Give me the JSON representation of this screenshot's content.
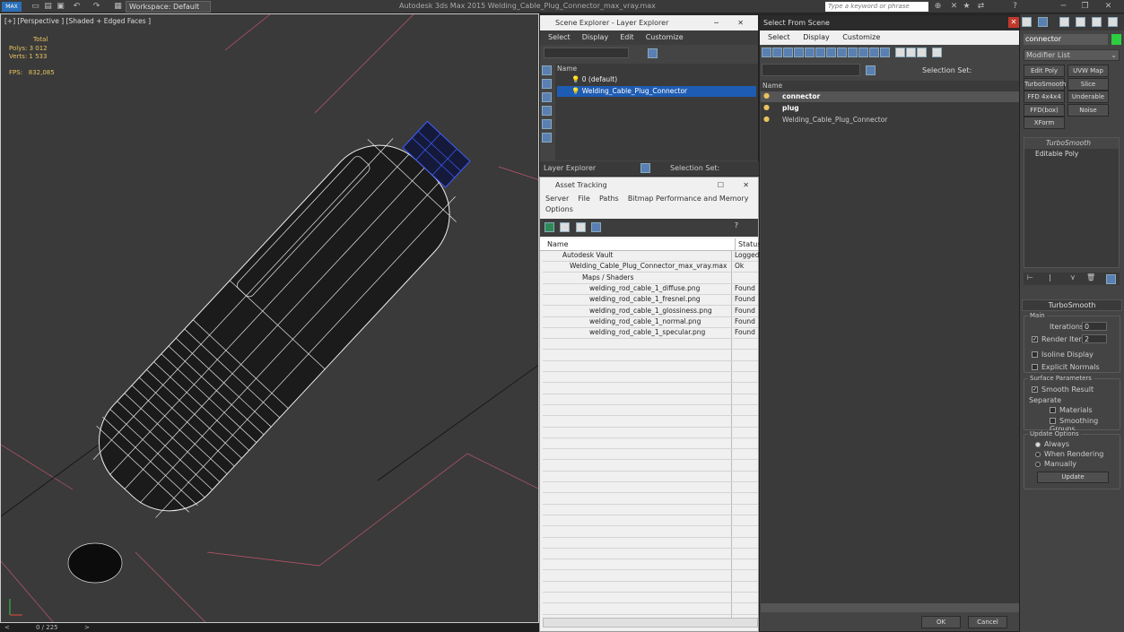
{
  "app": {
    "title": "Autodesk 3ds Max  2015    Welding_Cable_Plug_Connector_max_vray.max",
    "workspace": "Workspace: Default",
    "search_placeholder": "Type a keyword or phrase",
    "logo": "MAX"
  },
  "viewport": {
    "label": "[+] [Perspective ] [Shaded + Edged Faces ]",
    "stats": {
      "total": "Total",
      "polys_label": "Polys:",
      "polys": "3 012",
      "verts_label": "Verts:",
      "verts": "1 533",
      "fps_label": "FPS:",
      "fps": "832,085"
    }
  },
  "statusbar": {
    "frame": "0 / 225"
  },
  "scene_explorer": {
    "title": "Scene Explorer - Layer Explorer",
    "menu": [
      "Select",
      "Display",
      "Edit",
      "Customize"
    ],
    "col_name": "Name",
    "items": [
      "0 (default)",
      "Welding_Cable_Plug_Connector"
    ],
    "footer_label": "Layer Explorer",
    "selection_set": "Selection Set:"
  },
  "asset_tracking": {
    "title": "Asset Tracking",
    "menu": [
      "Server",
      "File",
      "Paths",
      "Bitmap Performance and Memory"
    ],
    "menu2": "Options",
    "col_name": "Name",
    "col_status": "Status",
    "rows": [
      {
        "name": "Autodesk Vault",
        "status": "Logged"
      },
      {
        "name": "Welding_Cable_Plug_Connector_max_vray.max",
        "status": "Ok"
      },
      {
        "name": "Maps / Shaders",
        "status": ""
      },
      {
        "name": "welding_rod_cable_1_diffuse.png",
        "status": "Found"
      },
      {
        "name": "welding_rod_cable_1_fresnel.png",
        "status": "Found"
      },
      {
        "name": "welding_rod_cable_1_glossiness.png",
        "status": "Found"
      },
      {
        "name": "welding_rod_cable_1_normal.png",
        "status": "Found"
      },
      {
        "name": "welding_rod_cable_1_specular.png",
        "status": "Found"
      }
    ]
  },
  "select_from_scene": {
    "title": "Select From Scene",
    "menu": [
      "Select",
      "Display",
      "Customize"
    ],
    "selection_set": "Selection Set:",
    "col_name": "Name",
    "items": [
      "connector",
      "plug",
      "Welding_Cable_Plug_Connector"
    ],
    "ok": "OK",
    "cancel": "Cancel"
  },
  "command_panel": {
    "object_name": "connector",
    "modifier_list": "Modifier List",
    "modifier_buttons": [
      "Edit Poly",
      "UVW Map",
      "TurboSmooth",
      "Slice",
      "FFD 4x4x4",
      "Underable Spli",
      "FFD(box)",
      "Noise",
      "XForm"
    ],
    "stack": [
      "TurboSmooth",
      "Editable Poly"
    ],
    "rollout_title": "TurboSmooth",
    "main": "Main",
    "iterations_label": "Iterations:",
    "iterations": "0",
    "render_iters_label": "Render Iters:",
    "render_iters": "2",
    "isoline": "Isoline Display",
    "explicit": "Explicit Normals",
    "surface": "Surface Parameters",
    "smooth_result": "Smooth Result",
    "separate": "Separate",
    "materials": "Materials",
    "smoothing_groups": "Smoothing Groups",
    "update_options": "Update Options",
    "always": "Always",
    "when_rendering": "When Rendering",
    "manually": "Manually",
    "update": "Update"
  },
  "colors": {
    "accent": "#1e5cb3",
    "yellow": "#e8c35e",
    "green": "#2ecc40",
    "viewport_bg": "#3a3a3a"
  }
}
